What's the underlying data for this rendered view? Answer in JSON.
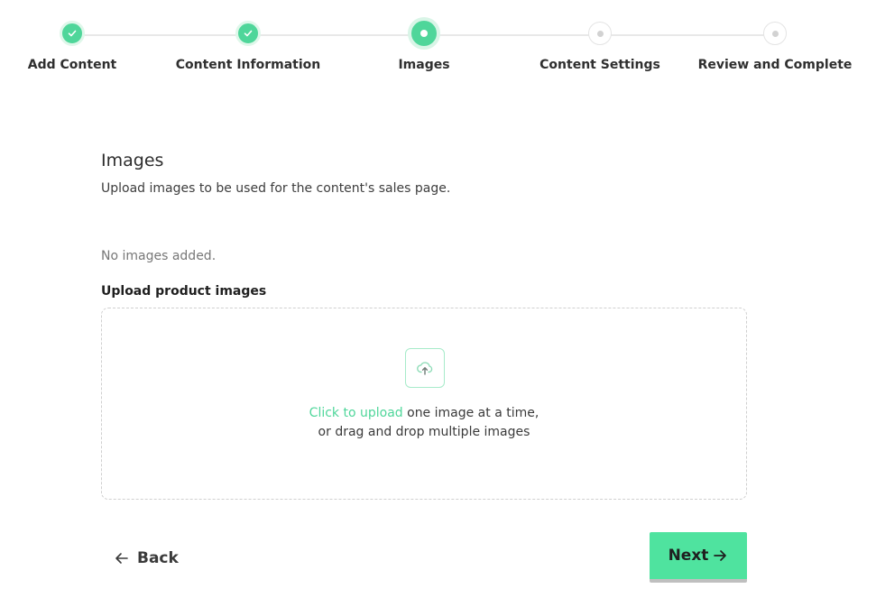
{
  "stepper": {
    "steps": [
      {
        "label": "Add Content",
        "state": "complete"
      },
      {
        "label": "Content Information",
        "state": "complete"
      },
      {
        "label": "Images",
        "state": "current"
      },
      {
        "label": "Content Settings",
        "state": "upcoming"
      },
      {
        "label": "Review and Complete",
        "state": "upcoming"
      }
    ]
  },
  "section": {
    "title": "Images",
    "subtitle": "Upload images to be used for the content's sales page.",
    "empty_state": "No images added."
  },
  "upload": {
    "label": "Upload product images",
    "click_text": "Click to upload",
    "line1_rest": " one image at a time,",
    "line2": "or drag and drop multiple images",
    "icon": "cloud-upload-icon"
  },
  "footer": {
    "back_label": "Back",
    "next_label": "Next"
  },
  "colors": {
    "accent": "#4fd69a",
    "button": "#4fe39f"
  }
}
